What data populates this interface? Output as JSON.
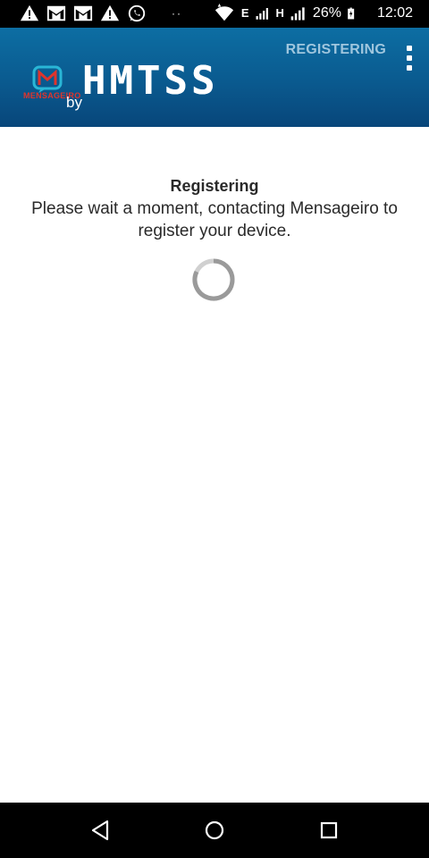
{
  "status_bar": {
    "battery_percent": "26%",
    "network_e": "E",
    "network_h": "H",
    "time": "12:02",
    "dots": "··",
    "icons": [
      "warning-icon",
      "mail-icon",
      "mail-icon",
      "warning-icon",
      "whatsapp-icon",
      "wifi-icon",
      "signal-icon",
      "signal-icon",
      "battery-charging-icon"
    ]
  },
  "app_bar": {
    "logo_caption": "MENSAGEIRO",
    "by_label": "by",
    "brand": "HMTSS",
    "action_label": "REGISTERING",
    "menu_icon": "overflow-menu-icon",
    "colors": {
      "background": "#0a5a8f",
      "action_text": "#9fc6de",
      "logo_red": "#e0342c",
      "logo_teal": "#29b6d6"
    }
  },
  "content": {
    "title": "Registering",
    "message": "Please wait a moment, contacting Mensageiro to register your device.",
    "spinner_icon": "loading-spinner-icon"
  },
  "nav_bar": {
    "buttons": [
      "back-icon",
      "home-icon",
      "recents-icon"
    ]
  }
}
